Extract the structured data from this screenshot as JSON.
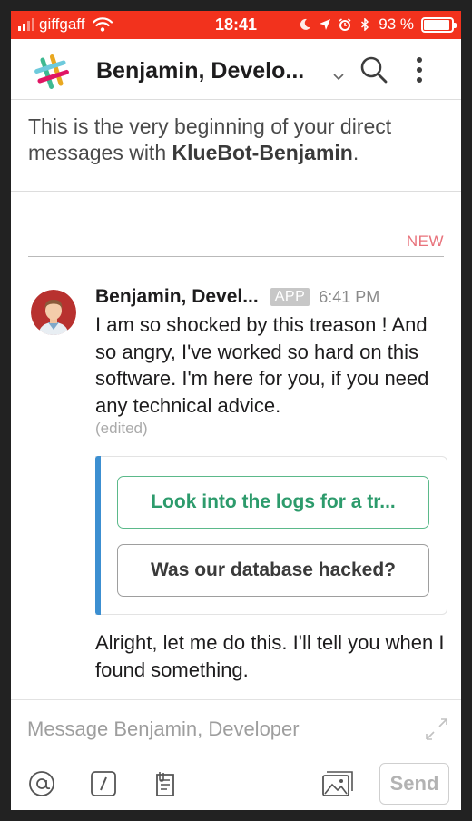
{
  "status_bar": {
    "carrier": "giffgaff",
    "time": "18:41",
    "battery_text": "93 %",
    "battery_level": 0.93,
    "icons": [
      "signal-icon",
      "wifi-icon",
      "moon-icon",
      "location-arrow-icon",
      "alarm-icon",
      "bluetooth-icon",
      "battery-icon"
    ]
  },
  "header": {
    "title": "Benjamin, Develo...",
    "icons": [
      "slack-logo",
      "chevron-down-icon",
      "search-icon",
      "more-vertical-icon"
    ]
  },
  "conversation": {
    "intro_prefix": "This is the very beginning of your direct messages with ",
    "intro_name": "KlueBot-Benjamin",
    "intro_suffix": ".",
    "new_marker": "NEW"
  },
  "message": {
    "sender": "Benjamin, Devel...",
    "badge": "APP",
    "timestamp": "6:41 PM",
    "text": "I am so shocked by this treason ! And so angry, I've worked so hard on this software. I'm here for you, if you need any technical advice.",
    "edited": "(edited)",
    "actions": [
      {
        "label": "Look into the logs for a tr..."
      },
      {
        "label": "Was our database hacked?"
      }
    ],
    "reply": "Alright, let me do this. I'll tell you when I found something."
  },
  "composer": {
    "placeholder": "Message Benjamin, Developer",
    "send_label": "Send",
    "tools": [
      "mention-icon",
      "slash-command-icon",
      "attach-file-icon",
      "image-icon",
      "expand-icon"
    ]
  },
  "colors": {
    "status_bar": "#f2321d",
    "new_marker": "#e8727b",
    "attachment_bar": "#3c8fd1",
    "primary_action": "#2d9b6c"
  }
}
